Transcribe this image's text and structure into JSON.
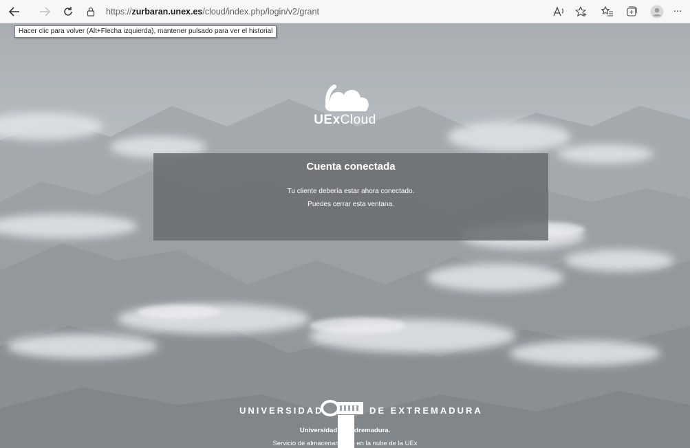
{
  "browser": {
    "url_prefix": "https://",
    "url_domain": "zurbaran.unex.es",
    "url_path": "/cloud/index.php/login/v2/grant",
    "tooltip": "Hacer clic para volver (Alt+Flecha izquierda), mantener pulsado para ver el historial",
    "menu_glyph": "···"
  },
  "logo": {
    "brand_bold": "UEx",
    "brand_rest": "Cloud"
  },
  "card": {
    "title": "Cuenta conectada",
    "line1": "Tu cliente debería estar ahora conectado.",
    "line2": "Puedes cerrar esta ventana."
  },
  "university": {
    "left": "UNIVERSIDAD",
    "right": "DE EXTREMADURA",
    "emblem_letters": "UEx"
  },
  "footer": {
    "line1": "Universidad de Extremadura.",
    "line2": "Servicio de almacenamiento en la nube de la UEx"
  },
  "colors": {
    "card_bg": "#696c6e",
    "toolbar_bg": "#f7f7f7",
    "text_on_page": "#ffffff"
  }
}
